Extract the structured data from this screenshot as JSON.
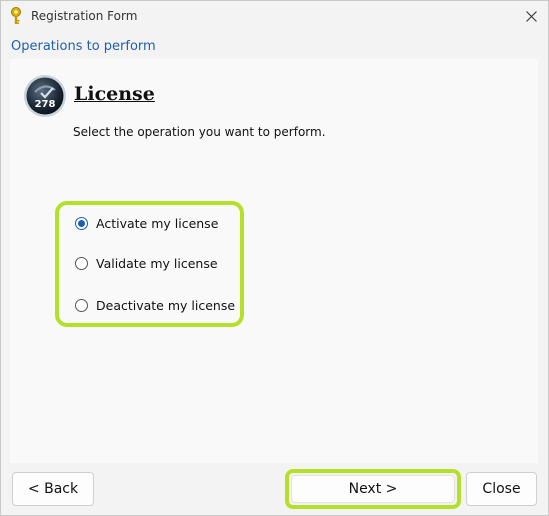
{
  "window": {
    "title": "Registration Form",
    "icon": "key-icon",
    "close_icon": "close-icon"
  },
  "header": {
    "section_title": "Operations to perform"
  },
  "content": {
    "logo": {
      "icon": "license-badge-icon",
      "number": "278"
    },
    "title": "License",
    "instruction": "Select the operation you want to perform.",
    "options": [
      {
        "label": "Activate my license",
        "selected": true
      },
      {
        "label": "Validate my license",
        "selected": false
      },
      {
        "label": "Deactivate my license",
        "selected": false
      }
    ]
  },
  "buttons": {
    "back": "< Back",
    "next": "Next >",
    "close": "Close"
  },
  "colors": {
    "highlight": "#b5e02a",
    "accent": "#1a5fb4",
    "section_title": "#1f5fb0"
  }
}
